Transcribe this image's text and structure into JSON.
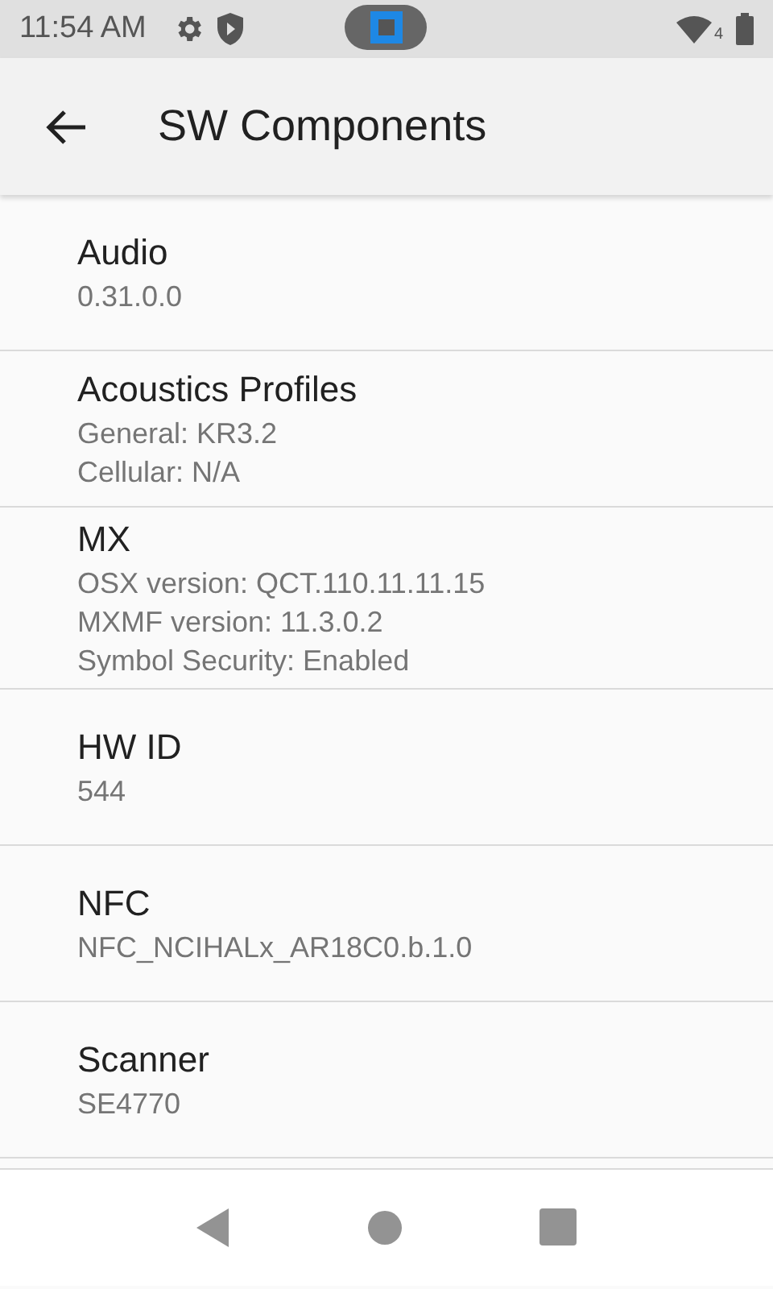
{
  "status_bar": {
    "time": "11:54 AM",
    "signal_badge": "4"
  },
  "app_bar": {
    "title": "SW Components"
  },
  "items": [
    {
      "title": "Audio",
      "lines": [
        "0.31.0.0"
      ]
    },
    {
      "title": "Acoustics Profiles",
      "lines": [
        "General: KR3.2",
        "Cellular: N/A"
      ]
    },
    {
      "title": "MX",
      "lines": [
        "OSX version: QCT.110.11.11.15",
        "MXMF version: 11.3.0.2",
        "Symbol Security: Enabled"
      ]
    },
    {
      "title": "HW ID",
      "lines": [
        "544"
      ]
    },
    {
      "title": "NFC",
      "lines": [
        "NFC_NCIHALx_AR18C0.b.1.0"
      ]
    },
    {
      "title": "Scanner",
      "lines": [
        "SE4770"
      ]
    }
  ]
}
